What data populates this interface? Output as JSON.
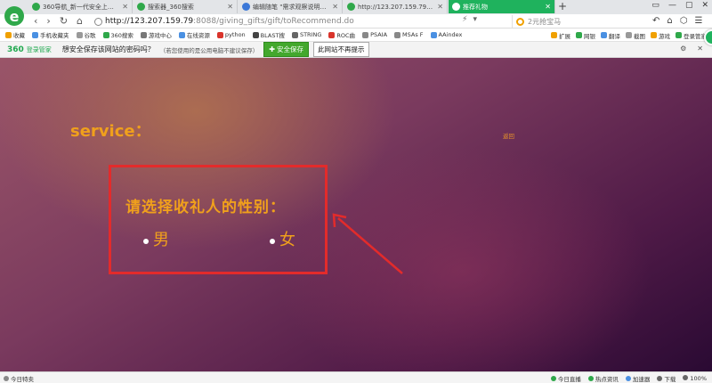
{
  "tabs": [
    {
      "label": "360导航_新一代安全上网导航",
      "color": "#2fa84a"
    },
    {
      "label": "搜索器_360搜索",
      "color": "#2fa84a"
    },
    {
      "label": "编辑随笔 \"需求观察说明文档\" -",
      "color": "#3b78d8"
    },
    {
      "label": "http://123.207.159.79：8088/g",
      "color": "#2fa84a"
    },
    {
      "label": "推荐礼物",
      "color": "#ffffff"
    }
  ],
  "new_tab": "+",
  "window_controls": [
    "▭",
    "—",
    "▢",
    "✕"
  ],
  "nav": {
    "back": "‹",
    "forward": "›",
    "refresh": "↻",
    "home": "⌂"
  },
  "address": {
    "url_main": "http://123.207.159.79",
    "url_rest": ":8088/giving_gifts/gift/toRecommend.do"
  },
  "address_icons": [
    "⚡",
    "▾"
  ],
  "search_placeholder": "2元抢宝马",
  "toolbar_icons": [
    "↶",
    "⌂",
    "⬡",
    "☰"
  ],
  "bookmarks": [
    {
      "label": "收藏",
      "color": "#f0a000"
    },
    {
      "label": "手机收藏夹",
      "color": "#4a90e2"
    },
    {
      "label": "谷歌",
      "color": "#999999"
    },
    {
      "label": "360搜索",
      "color": "#2fa84a"
    },
    {
      "label": "游戏中心",
      "color": "#777777"
    },
    {
      "label": "在线资源",
      "color": "#4a90e2"
    },
    {
      "label": "python",
      "color": "#d9342b"
    },
    {
      "label": "BLAST搜",
      "color": "#444444"
    },
    {
      "label": "STRING",
      "color": "#666666"
    },
    {
      "label": "ROC曲",
      "color": "#d9342b"
    },
    {
      "label": "PSAIA",
      "color": "#888888"
    },
    {
      "label": "MSAs F",
      "color": "#888888"
    },
    {
      "label": "AAindex",
      "color": "#4a90e2"
    }
  ],
  "bookmarks_right": [
    {
      "label": "扩展",
      "color": "#f0a000"
    },
    {
      "label": "网银",
      "color": "#2fa84a"
    },
    {
      "label": "翻译",
      "color": "#4a90e2"
    },
    {
      "label": "截图",
      "color": "#999999"
    },
    {
      "label": "游戏",
      "color": "#f0a000"
    },
    {
      "label": "登录管家",
      "color": "#2fa84a"
    }
  ],
  "password_bar": {
    "brand": "360",
    "brand_sub": "登录管家",
    "question": "想安全保存该网站的密码吗？",
    "hint": "（若您使用的是公用电脑不建议保存）",
    "save_button": "安全保存",
    "never_button": "此网站不再提示",
    "controls": [
      "⚙",
      "✕"
    ]
  },
  "page": {
    "service_label": "service：",
    "back_link": "返回",
    "question": "请选择收礼人的性别：",
    "option_male": "男",
    "option_female": "女"
  },
  "annotation_color": "#e32b2b",
  "status_bar": {
    "left": "今日特卖",
    "right": [
      {
        "label": "今日直播",
        "color": "#2fa84a"
      },
      {
        "label": "热点资讯",
        "color": "#2fa84a"
      },
      {
        "label": "加速器",
        "color": "#4a90e2"
      },
      {
        "label": "下载",
        "color": "#666666"
      },
      {
        "label": "100%",
        "color": "#666666"
      }
    ]
  }
}
